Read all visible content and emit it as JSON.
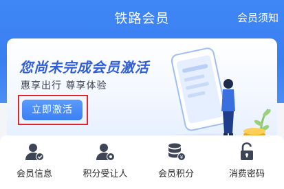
{
  "header": {
    "title": "铁路会员",
    "notice_label": "会员须知"
  },
  "banner": {
    "title": "您尚未完成会员激活",
    "subtitle": "惠享出行 尊享体验",
    "activate_button": "立即激活"
  },
  "menu": [
    {
      "label": "会员信息",
      "icon": "user-check-icon"
    },
    {
      "label": "积分受让人",
      "icon": "user-gear-icon"
    },
    {
      "label": "会员积分",
      "icon": "coin-stack-icon"
    },
    {
      "label": "消费密码",
      "icon": "unlock-icon"
    }
  ],
  "colors": {
    "header_blue": "#3f86f6",
    "title_blue": "#2f5fd8",
    "highlight_red": "#e0262b",
    "icon_gray": "#3e4556"
  }
}
